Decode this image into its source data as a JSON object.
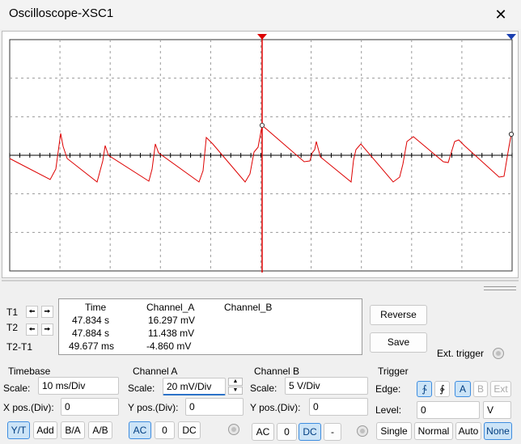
{
  "window": {
    "title": "Oscilloscope-XSC1",
    "close_glyph": "✕"
  },
  "trace_color": "#dd0000",
  "cursor_color": "#dd0000",
  "readout": {
    "t1_label": "T1",
    "t2_label": "T2",
    "t2t1_label": "T2-T1",
    "headers": {
      "time": "Time",
      "channel_a": "Channel_A",
      "channel_b": "Channel_B"
    },
    "rows": [
      {
        "time": "47.834 s",
        "channel_a": "16.297 mV",
        "channel_b": ""
      },
      {
        "time": "47.884 s",
        "channel_a": "11.438 mV",
        "channel_b": ""
      },
      {
        "time": "49.677 ms",
        "channel_a": "-4.860 mV",
        "channel_b": ""
      }
    ]
  },
  "buttons": {
    "reverse": "Reverse",
    "save": "Save",
    "ext_trigger": "Ext. trigger"
  },
  "timebase": {
    "title": "Timebase",
    "scale_label": "Scale:",
    "scale_value": "10 ms/Div",
    "xpos_label": "X pos.(Div):",
    "xpos_value": "0",
    "modes": [
      "Y/T",
      "Add",
      "B/A",
      "A/B"
    ],
    "selected_mode": "Y/T"
  },
  "channel_a": {
    "title": "Channel A",
    "scale_label": "Scale:",
    "scale_value": "20 mV/Div",
    "ypos_label": "Y pos.(Div):",
    "ypos_value": "0",
    "coupling": [
      "AC",
      "0",
      "DC"
    ],
    "selected_coupling": "AC"
  },
  "channel_b": {
    "title": "Channel B",
    "scale_label": "Scale:",
    "scale_value": "5  V/Div",
    "ypos_label": "Y pos.(Div):",
    "ypos_value": "0",
    "coupling": [
      "AC",
      "0",
      "DC",
      "-"
    ],
    "selected_coupling": "DC"
  },
  "trigger": {
    "title": "Trigger",
    "edge_label": "Edge:",
    "edge_rising": "∱",
    "edge_falling": "∲",
    "sources": [
      "A",
      "B",
      "Ext"
    ],
    "selected_source": "A",
    "level_label": "Level:",
    "level_value": "0",
    "level_unit": "V",
    "modes": [
      "Single",
      "Normal",
      "Auto",
      "None"
    ],
    "selected_mode": "None"
  }
}
